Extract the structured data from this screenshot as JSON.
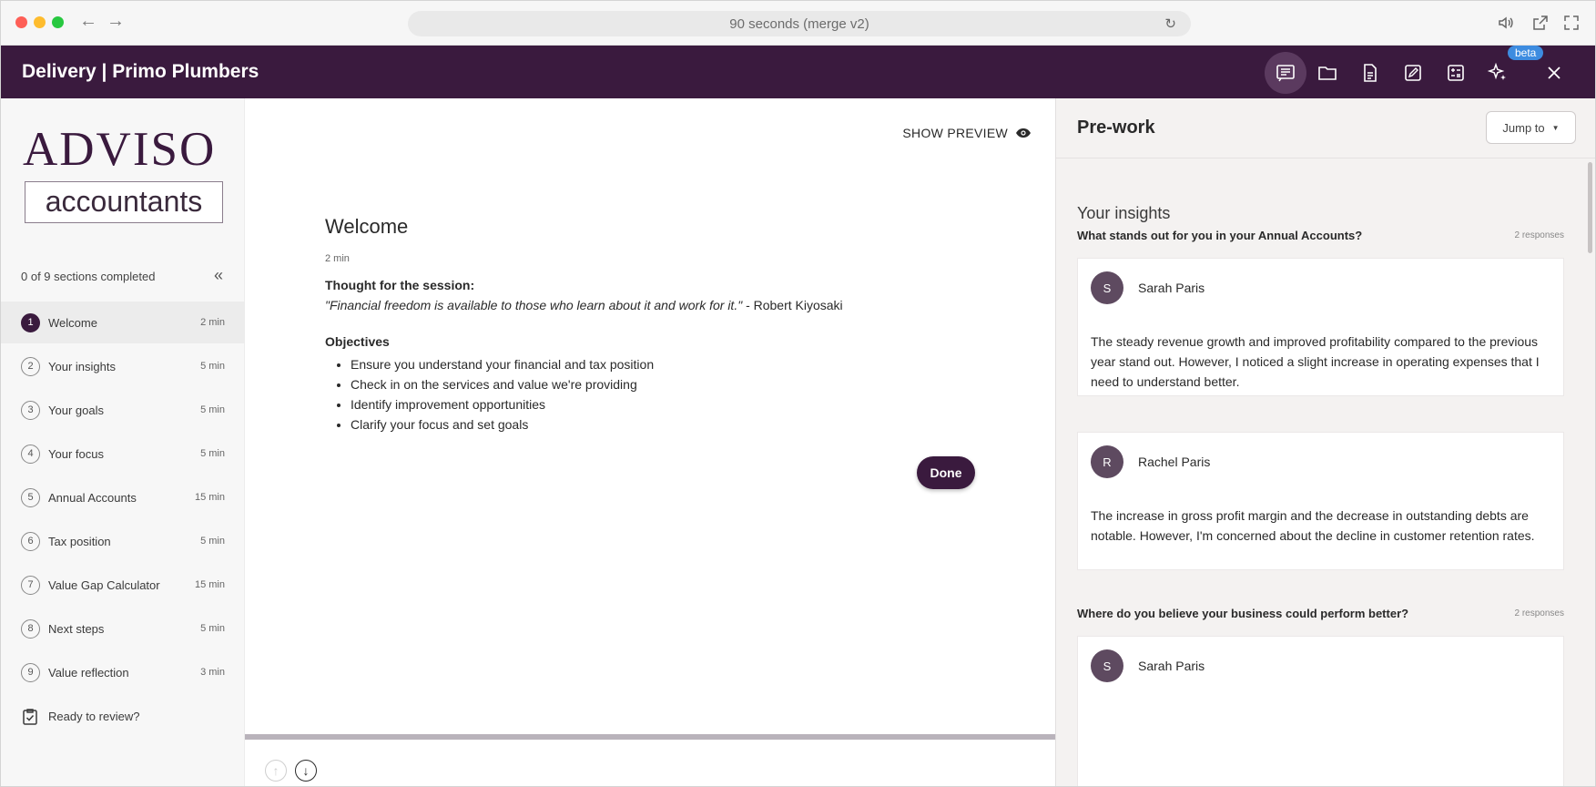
{
  "browser": {
    "url_title": "90 seconds (merge v2)"
  },
  "header": {
    "title": "Delivery | Primo Plumbers",
    "beta_label": "beta"
  },
  "sidebar": {
    "logo_top": "ADVISO",
    "logo_bottom": "accountants",
    "progress": "0 of 9 sections completed",
    "sections": [
      {
        "num": "1",
        "label": "Welcome",
        "duration": "2 min"
      },
      {
        "num": "2",
        "label": "Your insights",
        "duration": "5 min"
      },
      {
        "num": "3",
        "label": "Your goals",
        "duration": "5 min"
      },
      {
        "num": "4",
        "label": "Your focus",
        "duration": "5 min"
      },
      {
        "num": "5",
        "label": "Annual Accounts",
        "duration": "15 min"
      },
      {
        "num": "6",
        "label": "Tax position",
        "duration": "5 min"
      },
      {
        "num": "7",
        "label": "Value Gap Calculator",
        "duration": "15 min"
      },
      {
        "num": "8",
        "label": "Next steps",
        "duration": "5 min"
      },
      {
        "num": "9",
        "label": "Value reflection",
        "duration": "3 min"
      }
    ],
    "review": "Ready to review?"
  },
  "main": {
    "show_preview": "SHOW PREVIEW",
    "heading": "Welcome",
    "duration": "2 min",
    "thought_heading": "Thought for the session:",
    "quote": "\"Financial freedom is available to those who learn about it and work for it.\"",
    "quote_author": " - Robert Kiyosaki",
    "objectives_heading": "Objectives",
    "objectives": [
      "Ensure you understand your financial and tax position",
      "Check in on the services and value we're providing",
      "Identify improvement opportunities",
      "Clarify your focus and set goals"
    ],
    "done_label": "Done"
  },
  "panel": {
    "title": "Pre-work",
    "jump_label": "Jump to",
    "section_heading": "Your insights",
    "questions": [
      {
        "question": "What stands out for you in your Annual Accounts?",
        "count": "2 responses",
        "responses": [
          {
            "initial": "S",
            "name": "Sarah Paris",
            "text": "The steady revenue growth and improved profitability compared to the previous year stand out. However, I noticed a slight increase in operating expenses that I need to understand better."
          },
          {
            "initial": "R",
            "name": "Rachel Paris",
            "text": "The increase in gross profit margin and the decrease in outstanding debts are notable. However, I'm concerned about the decline in customer retention rates."
          }
        ]
      },
      {
        "question": "Where do you believe your business could perform better?",
        "count": "2 responses",
        "responses": [
          {
            "initial": "S",
            "name": "Sarah Paris",
            "text": ""
          }
        ]
      }
    ]
  },
  "colors": {
    "brand": "#3a1a3e",
    "beta": "#3d8ce0"
  }
}
